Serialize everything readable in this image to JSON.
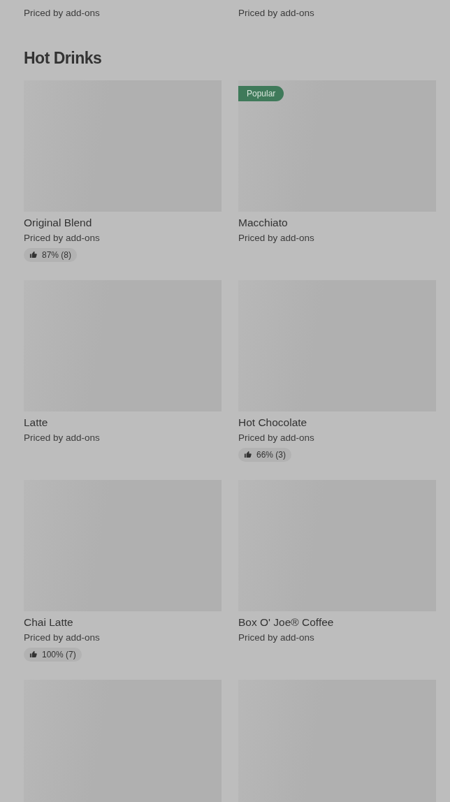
{
  "previous_items": [
    {
      "subtitle": "Priced by add-ons"
    },
    {
      "subtitle": "Priced by add-ons"
    }
  ],
  "section": {
    "title": "Hot Drinks"
  },
  "rows": [
    {
      "items": [
        {
          "kind": "card",
          "name": "Original Blend",
          "subtitle": "Priced by add-ons",
          "rating": "87% (8)"
        },
        {
          "kind": "card",
          "badge": "Popular",
          "name": "Macchiato",
          "subtitle": "Priced by add-ons"
        }
      ]
    },
    {
      "items": [
        {
          "kind": "card",
          "name": "Latte",
          "subtitle": "Priced by add-ons"
        },
        {
          "kind": "card",
          "name": "Hot Chocolate",
          "subtitle": "Priced by add-ons",
          "rating": "66% (3)"
        }
      ]
    },
    {
      "items": [
        {
          "kind": "card",
          "name": "Chai Latte",
          "subtitle": "Priced by add-ons",
          "rating": "100% (7)"
        },
        {
          "kind": "card",
          "name": "Box O' Joe® Coffee",
          "subtitle": "Priced by add-ons"
        }
      ]
    },
    {
      "items": [
        {
          "kind": "card"
        },
        {
          "kind": "card"
        }
      ]
    }
  ]
}
